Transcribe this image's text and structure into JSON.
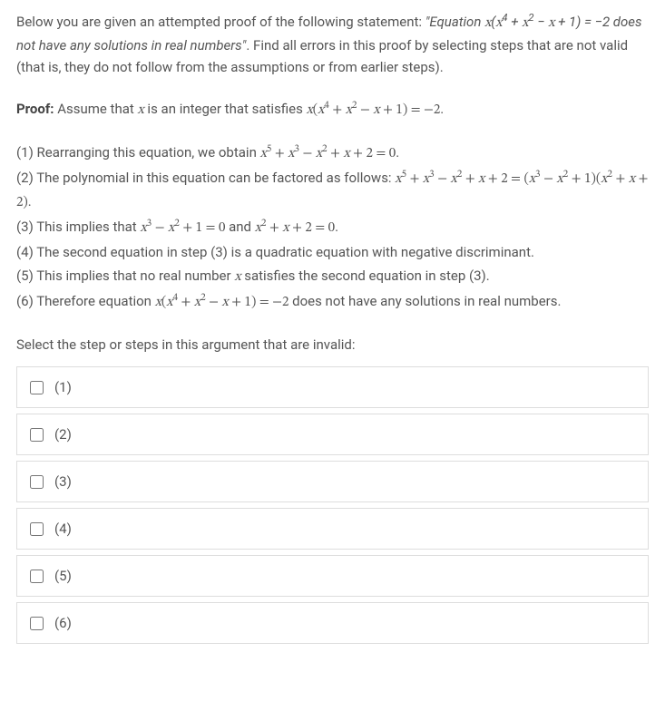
{
  "intro": {
    "prefix": "Below you are given an attempted proof of the following statement: ",
    "quoted_text_before": "\"Equation ",
    "quoted_eq": "x(x⁴ + x² − x + 1) = −2",
    "quoted_text_after": " does not have any solutions in real numbers\"",
    "suffix": ". Find all errors in this proof by selecting steps that are not valid (that is, they do not follow from the assumptions or from earlier steps)."
  },
  "proof": {
    "label": "Proof:",
    "assume_before": " Assume that ",
    "var": "x",
    "assume_mid": " is an integer that satisfies ",
    "assume_eq": "x(x⁴ + x² − x + 1) = −2",
    "period": "."
  },
  "steps": [
    {
      "text_parts": [
        {
          "t": "(1) Rearranging this equation, we obtain "
        },
        {
          "m": "x⁵ + x³ − x² + x + 2 = 0"
        },
        {
          "t": "."
        }
      ]
    },
    {
      "text_parts": [
        {
          "t": "(2) The polynomial in this equation can be factored as follows: "
        },
        {
          "m": "x⁵ + x³ − x² + x + 2 = (x³ − x² + 1)(x² + x + 2)"
        },
        {
          "t": "."
        }
      ]
    },
    {
      "text_parts": [
        {
          "t": "(3) This implies that "
        },
        {
          "m": "x³ − x² + 1 = 0"
        },
        {
          "t": " and "
        },
        {
          "m": "x² + x + 2 = 0"
        },
        {
          "t": "."
        }
      ]
    },
    {
      "text_parts": [
        {
          "t": "(4) The second equation in step (3) is a quadratic equation with negative discriminant."
        }
      ]
    },
    {
      "text_parts": [
        {
          "t": "(5) This implies that no real number "
        },
        {
          "v": "x"
        },
        {
          "t": " satisfies the second equation in step (3)."
        }
      ]
    },
    {
      "text_parts": [
        {
          "t": "(6) Therefore equation "
        },
        {
          "m": "x(x⁴ + x² − x + 1) = −2"
        },
        {
          "t": " does not have any solutions in real numbers."
        }
      ]
    }
  ],
  "select_prompt": "Select the step or steps in this argument that are invalid:",
  "options": [
    {
      "label": "(1)"
    },
    {
      "label": "(2)"
    },
    {
      "label": "(3)"
    },
    {
      "label": "(4)"
    },
    {
      "label": "(5)"
    },
    {
      "label": "(6)"
    }
  ]
}
